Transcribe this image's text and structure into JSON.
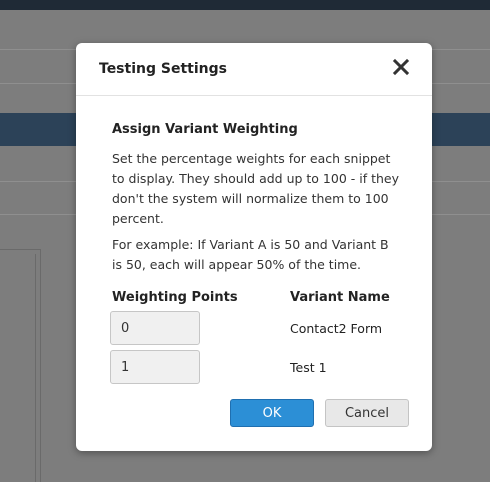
{
  "dialog": {
    "title": "Testing Settings",
    "section_title": "Assign Variant Weighting",
    "description_1": "Set the percentage weights for each snippet to display. They should add up to 100 - if they don't the system will normalize them to 100 percent.",
    "description_2": "For example: If Variant A is 50 and Variant B is 50, each will appear 50% of the time.",
    "columns": {
      "weighting_points": "Weighting Points",
      "variant_name": "Variant Name"
    },
    "rows": [
      {
        "weight": "0",
        "name": "Contact2 Form"
      },
      {
        "weight": "1",
        "name": "Test 1"
      }
    ],
    "ok_label": "OK",
    "cancel_label": "Cancel"
  },
  "icons": {
    "close": "close-icon"
  },
  "colors": {
    "ok_button": "#2c8fd6",
    "overlay": "#7d7d7d",
    "band": "#2c4258"
  }
}
